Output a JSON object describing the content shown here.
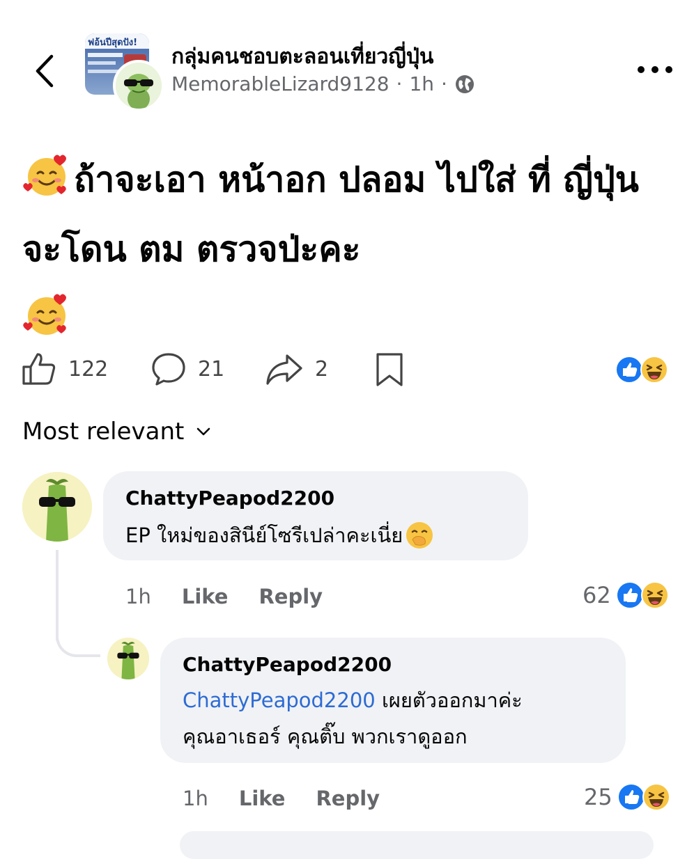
{
  "header": {
    "group_name": "กลุ่มคนชอบตะลอนเที่ยวญี่ปุ่น",
    "author": "MemorableLizard9128",
    "separator": "·",
    "time": "1h",
    "thumb_text": "ฟอ้นปีสุดปัง!",
    "back_icon": "chevron-left-icon",
    "privacy_icon": "globe-icon",
    "more_icon": "more-horizontal-icon"
  },
  "post": {
    "text": "ถ้าจะเอา หน้าอก ปลอม ไปใส่ ที่ ญี่ปุ่น จะโดน ตม ตรวจป่ะคะ",
    "leading_emoji": "smiling-face-with-hearts-icon",
    "trailing_emoji": "smiling-face-with-hearts-icon"
  },
  "actions": {
    "like_count": "122",
    "comment_count": "21",
    "share_count": "2",
    "reactions": [
      "like-reaction-icon",
      "haha-reaction-icon"
    ]
  },
  "sort": {
    "label": "Most relevant"
  },
  "comments": [
    {
      "author": "ChattyPeapod2200",
      "text": "EP ใหม่ของสินีย์โซรีเปล่าคะเนี่ย",
      "emoji": "face-with-hand-over-mouth-icon",
      "time": "1h",
      "like_label": "Like",
      "reply_label": "Reply",
      "reaction_count": "62"
    },
    {
      "author": "ChattyPeapod2200",
      "mention": "ChattyPeapod2200",
      "text_line1": " เผยตัวออกมาค่ะ",
      "text_line2": "คุณอาเธอร์ คุณติ๊บ พวกเราดูออก",
      "time": "1h",
      "like_label": "Like",
      "reply_label": "Reply",
      "reaction_count": "25"
    }
  ],
  "colors": {
    "link_blue": "#2d6bd3",
    "like_blue": "#1877f2",
    "bubble_bg": "#f0f2f5",
    "meta_gray": "#65676b"
  }
}
